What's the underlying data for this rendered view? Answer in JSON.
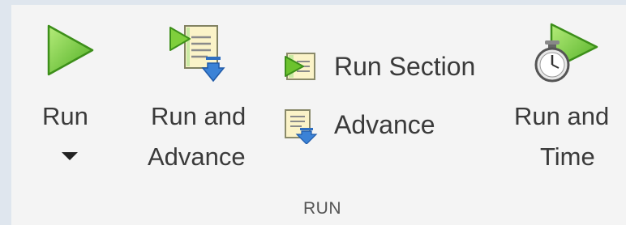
{
  "toolstrip": {
    "group_label": "RUN",
    "run": {
      "label": "Run",
      "icon": "play-icon"
    },
    "run_and_advance": {
      "label_line1": "Run and",
      "label_line2": "Advance",
      "icon": "run-and-advance-icon"
    },
    "run_section": {
      "label": "Run Section",
      "icon": "run-section-icon"
    },
    "advance": {
      "label": "Advance",
      "icon": "advance-icon"
    },
    "run_and_time": {
      "label_line1": "Run and",
      "label_line2": "Time",
      "icon": "stopwatch-play-icon"
    }
  },
  "colors": {
    "play_green": "#5cb82e",
    "play_green_light": "#9be05d",
    "panel_bg": "#f4f4f4",
    "outer_bg": "#dfe6ee",
    "text": "#3a3a3a"
  }
}
